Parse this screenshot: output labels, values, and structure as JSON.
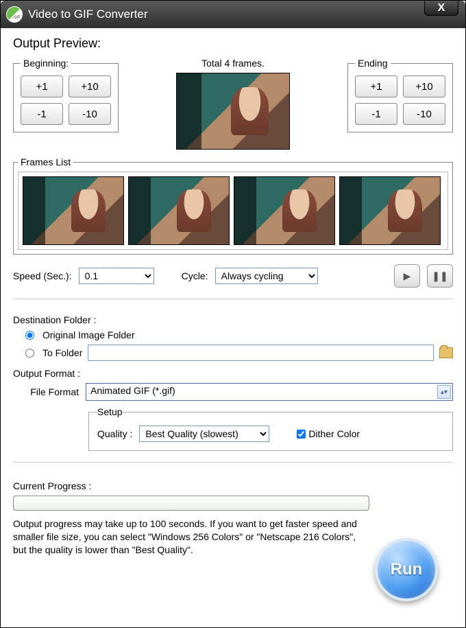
{
  "window": {
    "title": "Video to GIF Converter",
    "close_glyph": "X"
  },
  "preview": {
    "heading": "Output Preview:",
    "beginning_legend": "Beginning:",
    "ending_legend": "Ending",
    "total_frames_label": "Total 4 frames.",
    "buttons": {
      "plus1": "+1",
      "plus10": "+10",
      "minus1": "-1",
      "minus10": "-10"
    }
  },
  "frames": {
    "legend": "Frames List",
    "count": 4
  },
  "controls": {
    "speed_label": "Speed (Sec.):",
    "speed_value": "0.1",
    "cycle_label": "Cycle:",
    "cycle_value": "Always cycling",
    "play_glyph": "▶",
    "pause_glyph": "❚❚"
  },
  "destination": {
    "heading": "Destination Folder :",
    "option_original": "Original Image Folder",
    "option_tofolder": "To Folder",
    "selected": "original",
    "path_value": ""
  },
  "output": {
    "heading": "Output Format :",
    "file_format_label": "File Format",
    "file_format_value": "Animated GIF (*.gif)",
    "setup_legend": "Setup",
    "quality_label": "Quality :",
    "quality_value": "Best Quality (slowest)",
    "dither_label": "Dither Color",
    "dither_checked": true
  },
  "progress": {
    "heading": "Current Progress :",
    "hint": "Output progress may take up to 100 seconds. If you want to get faster speed and smaller file size, you can select \"Windows 256 Colors\" or \"Netscape 216 Colors\", but the quality is lower than \"Best Quality\"."
  },
  "run": {
    "label": "Run"
  }
}
